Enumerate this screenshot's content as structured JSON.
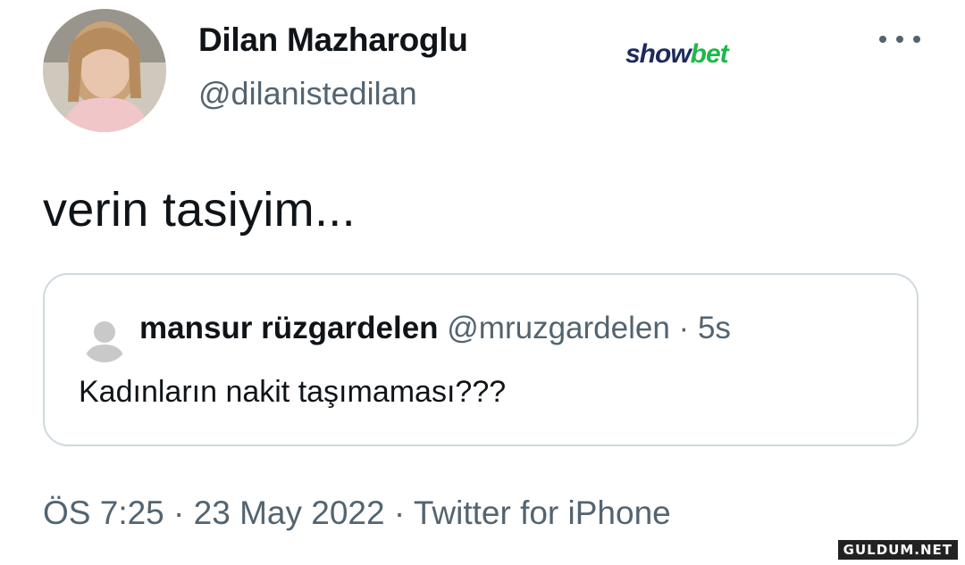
{
  "tweet": {
    "author_name": "Dilan Mazharoglu",
    "author_handle": "@dilanistedilan",
    "text": "verin tasiyim...",
    "more_icon": "more-horizontal-icon",
    "timestamp_time": "ÖS 7:25",
    "timestamp_date": "23 May 2022",
    "separator": "·",
    "source": "Twitter for iPhone"
  },
  "quote": {
    "author_name": "mansur rüzgardelen",
    "author_handle": "@mruzgardelen",
    "separator": "·",
    "time": "5s",
    "text": "Kadınların nakit taşımaması???",
    "avatar_icon": "default-avatar-icon"
  },
  "brand": {
    "part1": "show",
    "part2": "bet",
    "color1": "#1d2a5c",
    "color2": "#1fb84b"
  },
  "watermark": "GULDUM.NET",
  "colors": {
    "text": "#0f1419",
    "secondary": "#536471",
    "border": "#cfd9de"
  }
}
